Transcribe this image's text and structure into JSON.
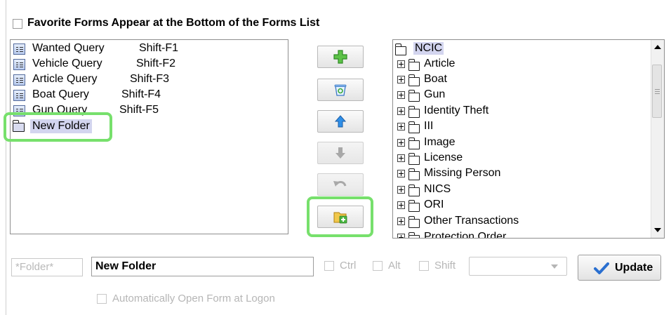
{
  "favorites_option": {
    "label": "Favorite Forms Appear at the Bottom of the Forms List",
    "checked": false
  },
  "favorites_list": {
    "items": [
      {
        "name": "Wanted Query",
        "shortcut": "Shift-F1"
      },
      {
        "name": "Vehicle Query",
        "shortcut": "Shift-F2"
      },
      {
        "name": "Article Query",
        "shortcut": "Shift-F3"
      },
      {
        "name": "Boat Query",
        "shortcut": "Shift-F4"
      },
      {
        "name": "Gun Query",
        "shortcut": "Shift-F5"
      }
    ],
    "new_folder": "New Folder"
  },
  "actions": {
    "icons": [
      "plus-icon",
      "recycle-bin-icon",
      "up-arrow-icon",
      "down-arrow-icon",
      "undo-icon",
      "new-folder-icon"
    ],
    "disabled": [
      "move-down",
      "undo"
    ]
  },
  "tree": {
    "root": "NCIC",
    "items": [
      "Article",
      "Boat",
      "Gun",
      "Identity Theft",
      "III",
      "Image",
      "License",
      "Missing Person",
      "NICS",
      "ORI",
      "Other Transactions",
      "Protection Order"
    ]
  },
  "editor": {
    "type_value": "*Folder*",
    "name_value": "New Folder",
    "ctrl_label": "Ctrl",
    "alt_label": "Alt",
    "shift_label": "Shift",
    "key_value": "",
    "update_label": "Update",
    "auto_open_label": "Automatically Open Form at Logon"
  },
  "colors": {
    "highlight": "#77e06c",
    "selection": "#d3d5ef",
    "update_check": "#2a6fd0"
  }
}
